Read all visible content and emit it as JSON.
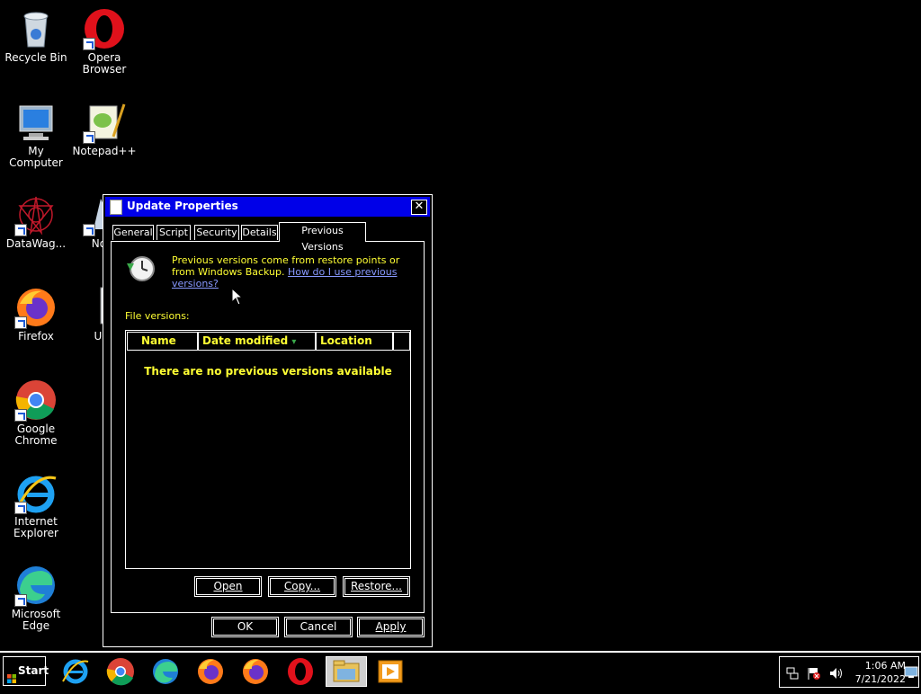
{
  "desktop": {
    "icons": [
      {
        "label": "Recycle Bin"
      },
      {
        "label": "Opera Browser"
      },
      {
        "label": "My Computer"
      },
      {
        "label": "Notepad++"
      },
      {
        "label": "DataWag..."
      },
      {
        "label": "Note"
      },
      {
        "label": "Firefox"
      },
      {
        "label": "Upc"
      },
      {
        "label": "Google Chrome"
      },
      {
        "label": "Internet Explorer"
      },
      {
        "label": "Microsoft Edge"
      }
    ]
  },
  "dialog": {
    "title": "Update Properties",
    "close_glyph": "✕",
    "tabs": [
      {
        "label": "General"
      },
      {
        "label": "Script"
      },
      {
        "label": "Security"
      },
      {
        "label": "Details"
      },
      {
        "label": "Previous Versions",
        "active": true
      }
    ],
    "info_text": "Previous versions come from restore points or from Windows Backup.",
    "info_link": "How do I use previous versions?",
    "file_versions_label": "File versions:",
    "columns": [
      {
        "label": "Name"
      },
      {
        "label": "Date modified"
      },
      {
        "label": "Location"
      }
    ],
    "sort_glyph": "▾",
    "empty_message": "There are no previous versions available",
    "list_buttons": {
      "open": "Open",
      "copy": "Copy...",
      "restore": "Restore..."
    },
    "footer_buttons": {
      "ok": "OK",
      "cancel": "Cancel",
      "apply": "Apply"
    }
  },
  "taskbar": {
    "start_label": "Start",
    "apps": [
      {
        "icon": "internet-explorer-icon"
      },
      {
        "icon": "chrome-icon"
      },
      {
        "icon": "edge-icon"
      },
      {
        "icon": "firefox-icon"
      },
      {
        "icon": "firefox-icon"
      },
      {
        "icon": "opera-icon"
      },
      {
        "icon": "file-explorer-icon",
        "active": true
      },
      {
        "icon": "media-player-icon"
      }
    ],
    "clock_time": "1:06 AM",
    "clock_date": "7/21/2022"
  },
  "colors": {
    "titlebar": "#0000e8",
    "accent_text": "#ffff33",
    "link": "#8899ff",
    "background": "#000000"
  }
}
